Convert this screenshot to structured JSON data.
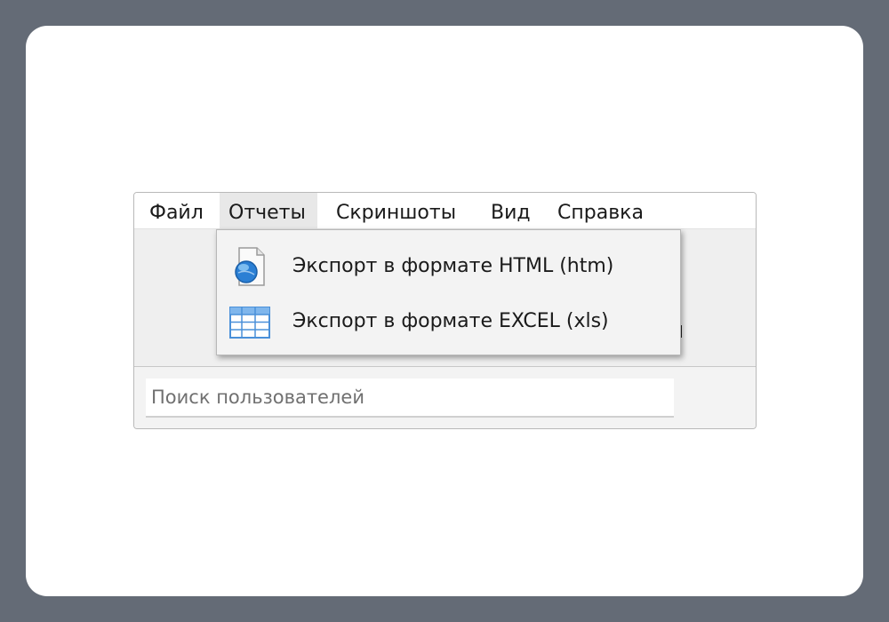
{
  "menubar": {
    "items": [
      {
        "label": "Файл"
      },
      {
        "label": "Отчеты"
      },
      {
        "label": "Скриншоты"
      },
      {
        "label": "Вид"
      },
      {
        "label": "Справка"
      }
    ],
    "active_index": 1
  },
  "reports_menu": {
    "items": [
      {
        "label": "Экспорт в формате HTML (htm)",
        "icon": "html-document-icon"
      },
      {
        "label": "Экспорт в формате EXCEL (xls)",
        "icon": "spreadsheet-icon"
      }
    ]
  },
  "search": {
    "placeholder": "Поиск пользователей",
    "value": ""
  },
  "colors": {
    "background": "#646b76",
    "card": "#ffffff",
    "menu_active": "#e8e8e8",
    "icon_blue": "#2b7fd4"
  }
}
